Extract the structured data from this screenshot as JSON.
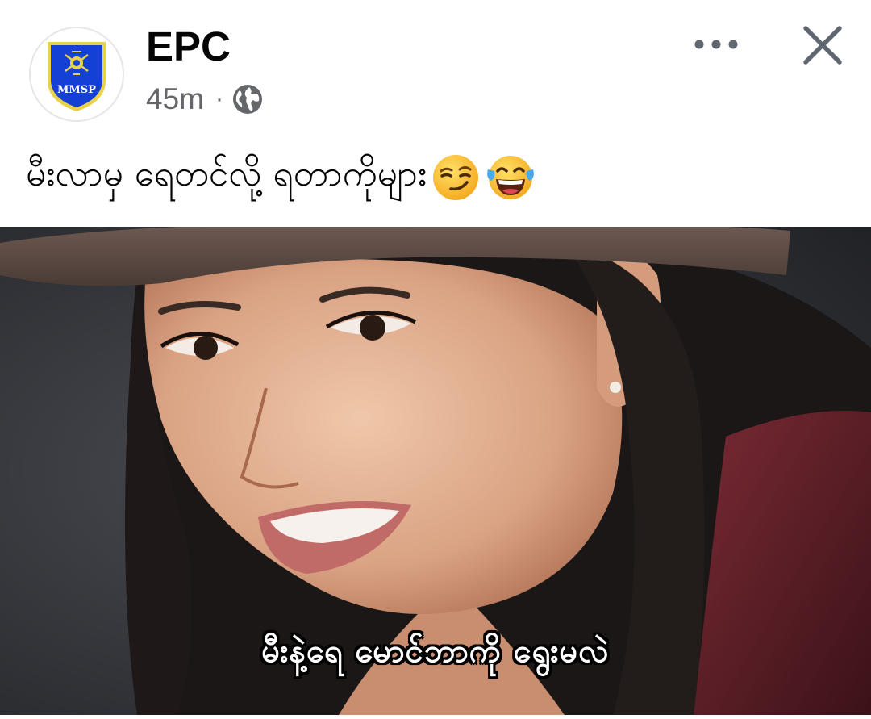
{
  "post": {
    "page_name": "EPC",
    "avatar": {
      "logo_text": "MMSP",
      "shield_color": "#1540d6",
      "shield_border": "#e8d24a"
    },
    "time_ago": "45m",
    "separator": "·",
    "audience_icon": "globe-icon",
    "more_icon": "more-horizontal-icon",
    "close_icon": "close-icon",
    "caption": "မီးလာမှ ရေတင်လို့ ရတာကိုများ",
    "caption_emojis": [
      "smirking-face-emoji",
      "face-with-tears-of-joy-emoji"
    ]
  },
  "photo": {
    "subtitle": "မီးနဲ့ရေ မောင်ဘာကို ရွေးမလဲ"
  },
  "colors": {
    "text_primary": "#050505",
    "text_secondary": "#65676b",
    "background": "#ffffff"
  }
}
